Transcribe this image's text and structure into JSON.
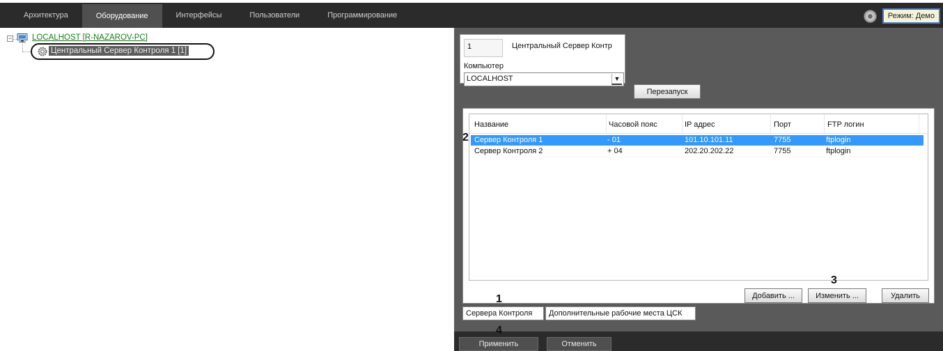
{
  "caption_fragment": "",
  "menubar": {
    "tabs": [
      "Архитектура",
      "Оборудование",
      "Интерфейсы",
      "Пользователи",
      "Программирование"
    ],
    "active_index": 1,
    "mode_label": "Режим: Демо"
  },
  "tree": {
    "root_label": "LOCALHOST [R-NAZAROV-PC]",
    "child_label": "Центральный Сервер Контроля 1 [1]"
  },
  "settings": {
    "id_value": "1",
    "name_value": "Центральный Сервер Контр",
    "computer_label": "Компьютер",
    "computer_value": "LOCALHOST",
    "restart_label": "Перезапуск"
  },
  "table": {
    "columns": [
      "Название",
      "Часовой пояс",
      "IP адрес",
      "Порт",
      "FTP логин"
    ],
    "rows": [
      {
        "name": "Сервер Контроля 1",
        "tz": "- 01",
        "ip": "101.10.101.11",
        "port": "7755",
        "ftp": "ftplogin",
        "selected": true
      },
      {
        "name": "Сервер Контроля 2",
        "tz": "+ 04",
        "ip": "202.20.202.22",
        "port": "7755",
        "ftp": "ftplogin",
        "selected": false
      }
    ]
  },
  "buttons": {
    "add": "Добавить ...",
    "edit": "Изменить ...",
    "delete": "Удалить",
    "apply": "Применить",
    "cancel": "Отменить"
  },
  "bottom_tabs": [
    "Сервера Контроля",
    "Дополнительные рабочие места ЦСК"
  ],
  "callouts": {
    "one": "1",
    "two": "2",
    "three": "3",
    "four": "4"
  },
  "colors": {
    "selection": "#3399ff",
    "menubar": "#2b2b2b",
    "panel": "#5a5a5a",
    "tree_root": "#1a7a1a"
  }
}
